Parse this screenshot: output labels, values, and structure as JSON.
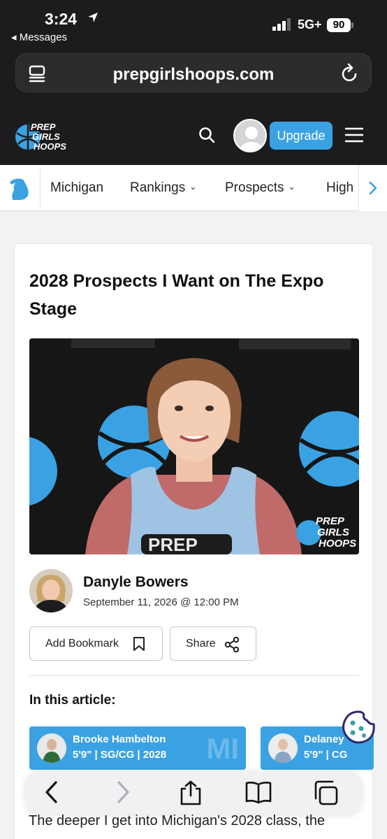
{
  "status_bar": {
    "time": "3:24",
    "back_app": "◂ Messages",
    "network": "5G+",
    "battery": "90"
  },
  "browser": {
    "url": "prepgirlshoops.com"
  },
  "site_header": {
    "logo_lines": [
      "PREP",
      "GIRLS",
      "HOOPS"
    ],
    "upgrade_label": "Upgrade"
  },
  "nav": {
    "items": [
      {
        "label": "Michigan"
      },
      {
        "label": "Rankings",
        "chevron": "⌄"
      },
      {
        "label": "Prospects",
        "chevron": "⌄"
      },
      {
        "label": "High"
      }
    ]
  },
  "article": {
    "title": "2028 Prospects I Want on The Expo Stage",
    "author": "Danyle Bowers",
    "date": "September 11, 2026 @ 12:00 PM",
    "bookmark_label": "Add Bookmark",
    "share_label": "Share",
    "in_this_article": "In this article:",
    "players": [
      {
        "name": "Brooke Hambelton",
        "meta": "5'9\" | SG/CG | 2028",
        "state": "MI"
      },
      {
        "name": "Delaney",
        "meta": "5'9\" | CG"
      }
    ],
    "body_start": "The deeper I get into Michigan's 2028 class, the"
  },
  "photo": {
    "watermark_lines": [
      "PREP",
      "GIRLS",
      "HOOPS"
    ],
    "jersey_text": "PREP"
  },
  "colors": {
    "accent": "#3aa2e3",
    "dark": "#1c1c1e",
    "card_bg": "#ffffff"
  }
}
